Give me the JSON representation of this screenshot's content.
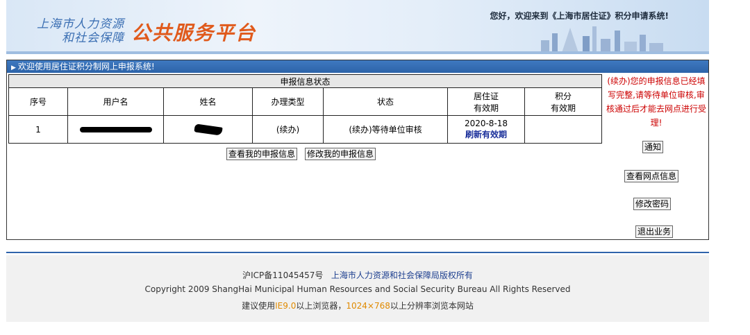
{
  "header": {
    "logo_line1": "上海市人力资源",
    "logo_line2": "和社会保障",
    "logo_big": "公共服务平台",
    "welcome": "您好，欢迎来到《上海市居住证》积分申请系统!"
  },
  "panel": {
    "title": "欢迎使用居住证积分制网上申报系统!",
    "table_caption": "申报信息状态",
    "columns": [
      "序号",
      "用户名",
      "姓名",
      "办理类型",
      "状态",
      "居住证",
      "有效期",
      "积分",
      "有效期"
    ],
    "row": {
      "index": "1",
      "type": "(续办)",
      "status": "(续办)等待单位审核",
      "residence_expiry": "2020-8-18",
      "refresh_link": "刷新有效期",
      "points_expiry": ""
    },
    "buttons": {
      "view_info": "查看我的申报信息",
      "modify_info": "修改我的申报信息"
    },
    "notice": "(续办)您的申报信息已经填写完整,请等待单位审核,审核通过后才能去网点进行受理!",
    "side_buttons": {
      "notify": "通知",
      "view_outlets": "查看网点信息",
      "change_password": "修改密码",
      "logout": "退出业务"
    }
  },
  "footer": {
    "icp": "沪ICP备11045457号",
    "owner": "上海市人力资源和社会保障局版权所有",
    "copyright": "Copyright 2009 ShangHai Municipal Human Resources and Social Security Bureau All Rights Reserved",
    "suggest_prefix": "建议使用",
    "browser": "IE9.0",
    "suggest_mid": "以上浏览器，",
    "resolution": "1024×768",
    "suggest_suffix": "以上分辨率浏览本网站"
  }
}
